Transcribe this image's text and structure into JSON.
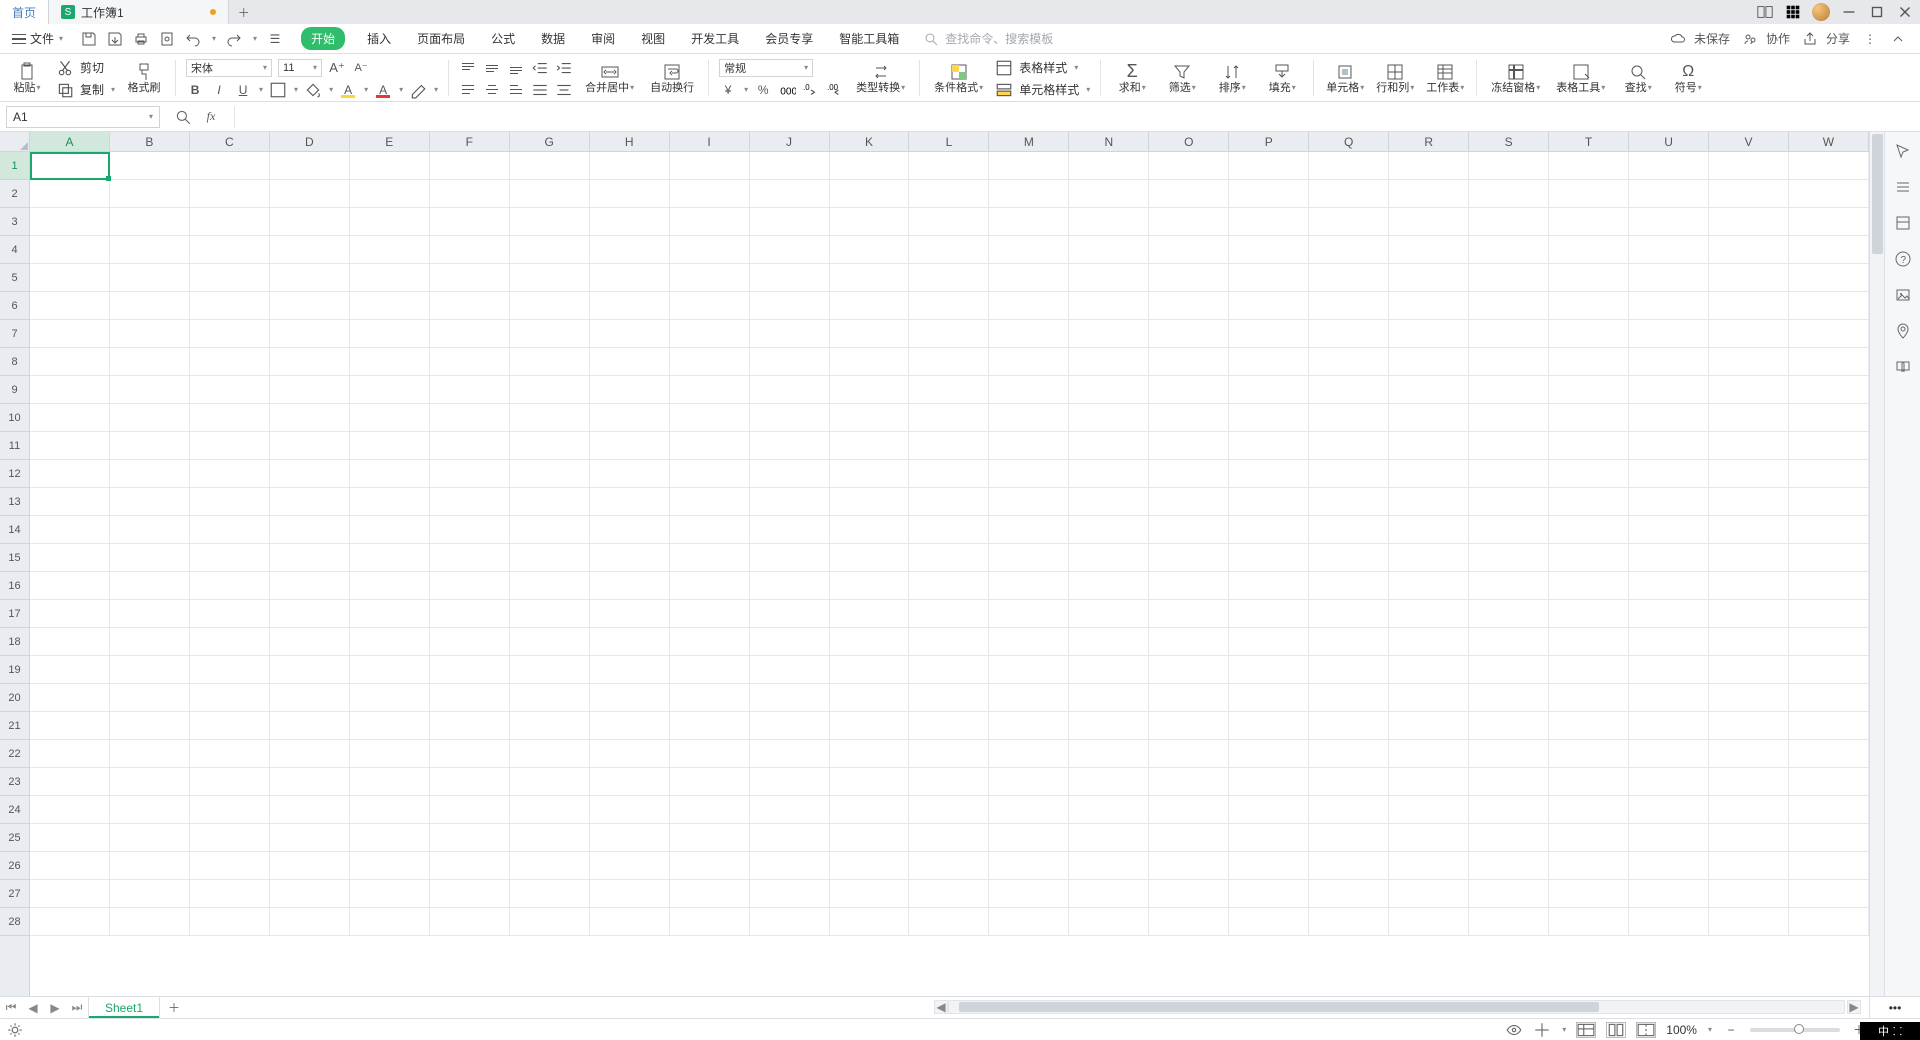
{
  "tabs": {
    "home": "首页",
    "doc_name": "工作簿1",
    "doc_icon_letter": "S"
  },
  "file_menu": "文件",
  "menu": {
    "start": "开始",
    "insert": "插入",
    "page_layout": "页面布局",
    "formula": "公式",
    "data": "数据",
    "review": "审阅",
    "view": "视图",
    "dev": "开发工具",
    "member": "会员专享",
    "smart": "智能工具箱"
  },
  "search_placeholder": "查找命令、搜索模板",
  "top_right": {
    "unsaved": "未保存",
    "collab": "协作",
    "share": "分享"
  },
  "ribbon": {
    "paste": "粘贴",
    "cut": "剪切",
    "copy": "复制",
    "format_painter": "格式刷",
    "font_name": "宋体",
    "font_size": "11",
    "merge": "合并居中",
    "wrap": "自动换行",
    "num_format": "常规",
    "type_convert": "类型转换",
    "cond_fmt": "条件格式",
    "table_style": "表格样式",
    "cell_style": "单元格样式",
    "sum": "求和",
    "filter": "筛选",
    "sort": "排序",
    "fill": "填充",
    "cell": "单元格",
    "rowcol": "行和列",
    "sheet": "工作表",
    "freeze": "冻结窗格",
    "table_tools": "表格工具",
    "find": "查找",
    "symbol": "符号"
  },
  "name_box": "A1",
  "columns": [
    "A",
    "B",
    "C",
    "D",
    "E",
    "F",
    "G",
    "H",
    "I",
    "J",
    "K",
    "L",
    "M",
    "N",
    "O",
    "P",
    "Q",
    "R",
    "S",
    "T",
    "U",
    "V",
    "W"
  ],
  "rows": [
    1,
    2,
    3,
    4,
    5,
    6,
    7,
    8,
    9,
    10,
    11,
    12,
    13,
    14,
    15,
    16,
    17,
    18,
    19,
    20,
    21,
    22,
    23,
    24,
    25,
    26,
    27,
    28
  ],
  "sheet_tab": "Sheet1",
  "zoom": "100%",
  "ime": "中"
}
